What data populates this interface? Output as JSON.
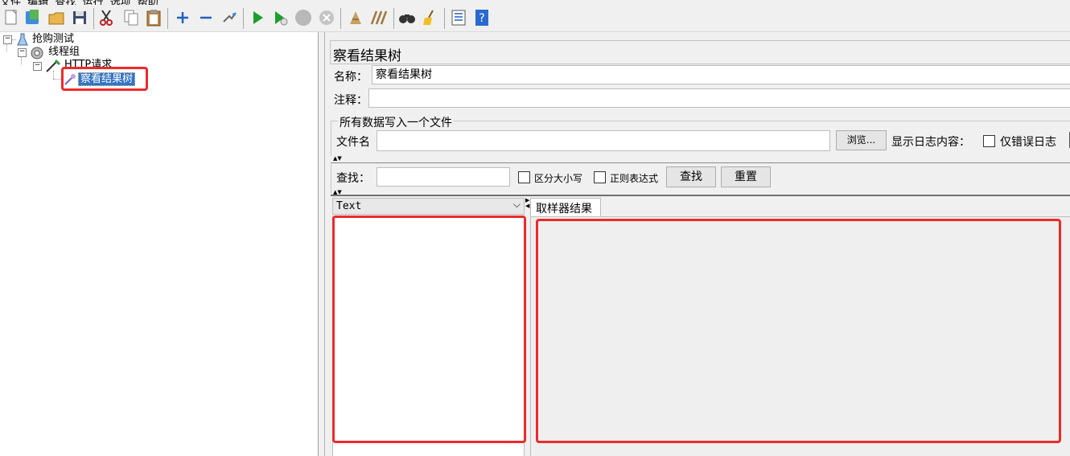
{
  "menubar": [
    "文件",
    "编辑",
    "查找",
    "运行",
    "选项",
    "帮助"
  ],
  "toolbar": {
    "items": [
      "new-icon",
      "templates-icon",
      "open-icon",
      "save-icon",
      "cut-icon",
      "copy-icon",
      "paste-icon",
      "expand-icon",
      "collapse-icon",
      "toggle-icon",
      "start-icon",
      "start-no-pause-icon",
      "stop-icon",
      "shutdown-icon",
      "clear-icon",
      "clear-all-icon",
      "search-icon",
      "reset-search-icon",
      "function-helper-icon",
      "help-icon"
    ]
  },
  "tree": {
    "test_plan": "抢购测试",
    "thread_group": "线程组",
    "http_request": "HTTP请求",
    "listener": "察看结果树"
  },
  "panel": {
    "title": "察看结果树",
    "name_label": "名称：",
    "name_value": "察看结果树",
    "comment_label": "注释：",
    "comment_value": "",
    "file_group_title": "所有数据写入一个文件",
    "filename_label": "文件名",
    "filename_value": "",
    "browse_button": "浏览...",
    "log_content_label": "显示日志内容：",
    "errors_only_label": "仅错误日志"
  },
  "search": {
    "label": "查找：",
    "value": "",
    "case_sensitive_label": "区分大小写",
    "regex_label": "正则表达式",
    "find_button": "查找",
    "reset_button": "重置"
  },
  "results": {
    "renderer_selected": "Text",
    "tab_sampler_result": "取样器结果"
  },
  "colors": {
    "highlight": "#ee2a2a",
    "selection": "#3173c6"
  }
}
